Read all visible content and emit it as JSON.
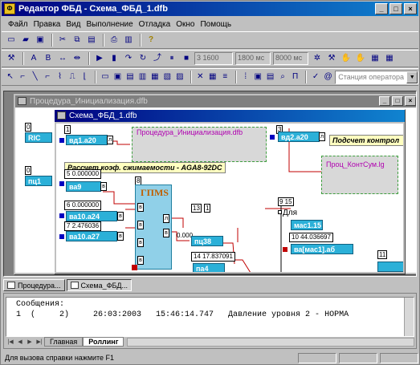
{
  "app": {
    "title": "Редактор ФБД - Схема_ФБД_1.dfb"
  },
  "menu": [
    "Файл",
    "Правка",
    "Вид",
    "Выполнение",
    "Отладка",
    "Окно",
    "Помощь"
  ],
  "toolbar2": {
    "field1": "3  1600",
    "field2": "1800 мс",
    "field3": "8000 мс"
  },
  "toolbar3": {
    "combo": "Станция оператора"
  },
  "win_back": {
    "title": "Процедура_Инициализация.dfb"
  },
  "win_front": {
    "title": "Схема_ФБД_1.dfb"
  },
  "diagram": {
    "b1_num": "1",
    "b1_label": "вд1.а20",
    "b1_out": "л",
    "sub1_title": "Процедура_Инициализация.dfb",
    "b3_num": "3",
    "b3_label": "вд2.а20",
    "b3_out": "л",
    "note1": "Подсчет контрол",
    "note2": "Рассчет коэф. сжимаемости - AGA8-92DC",
    "sub2_title": "Проц_КонтСум.lg",
    "v5_num": "5",
    "v5_val": "0.000000",
    "b5_label": "ва9",
    "b5_out": "в",
    "v6_num": "6",
    "v6_val": "0.000000",
    "b6_label": "ва10.а24",
    "b6_out": "в",
    "v7_num": "7",
    "v7_val": "2.476036",
    "b7_label": "ва10.а27",
    "b7_out": "в",
    "gost_num": "8",
    "gost_label": "ГПМS",
    "gp_in1": "в",
    "gp_in2": "в",
    "gp_in3": "в",
    "gp_in4": "в",
    "gp_out1": "л",
    "gp_out2": "в",
    "g_val": "0.000",
    "b13_num": "13",
    "b13_pin": "1",
    "b13_label": "пц38",
    "b14_num": "14",
    "b14_val": "17.837091",
    "b14_label": "па4",
    "for_nums": "9 15",
    "for_label": "Для",
    "b_mac_label": "мас1.15",
    "v10_num": "10",
    "v10_val": "44.036697",
    "b10_label": "ва[мас1].аб",
    "b11_num": "11",
    "left_num1": "0",
    "left_lbl1": "RIC",
    "left_num2": "0",
    "left_lbl2": "пц1"
  },
  "tabs": [
    {
      "label": "Процедура..."
    },
    {
      "label": "Схема_ФБД..."
    }
  ],
  "messages": {
    "header": "Сообщения:",
    "rows": [
      "1  (     2)     26:03:2003   15:46:14.747   Давление уровня 2 - НОРМА"
    ],
    "tabs": [
      "Главная",
      "Роллинг"
    ]
  },
  "status": {
    "text": "Для вызова справки нажмите F1"
  },
  "colors": {
    "block": "#2bb0d8",
    "title_active": "#000080",
    "note": "#ffffc0"
  }
}
